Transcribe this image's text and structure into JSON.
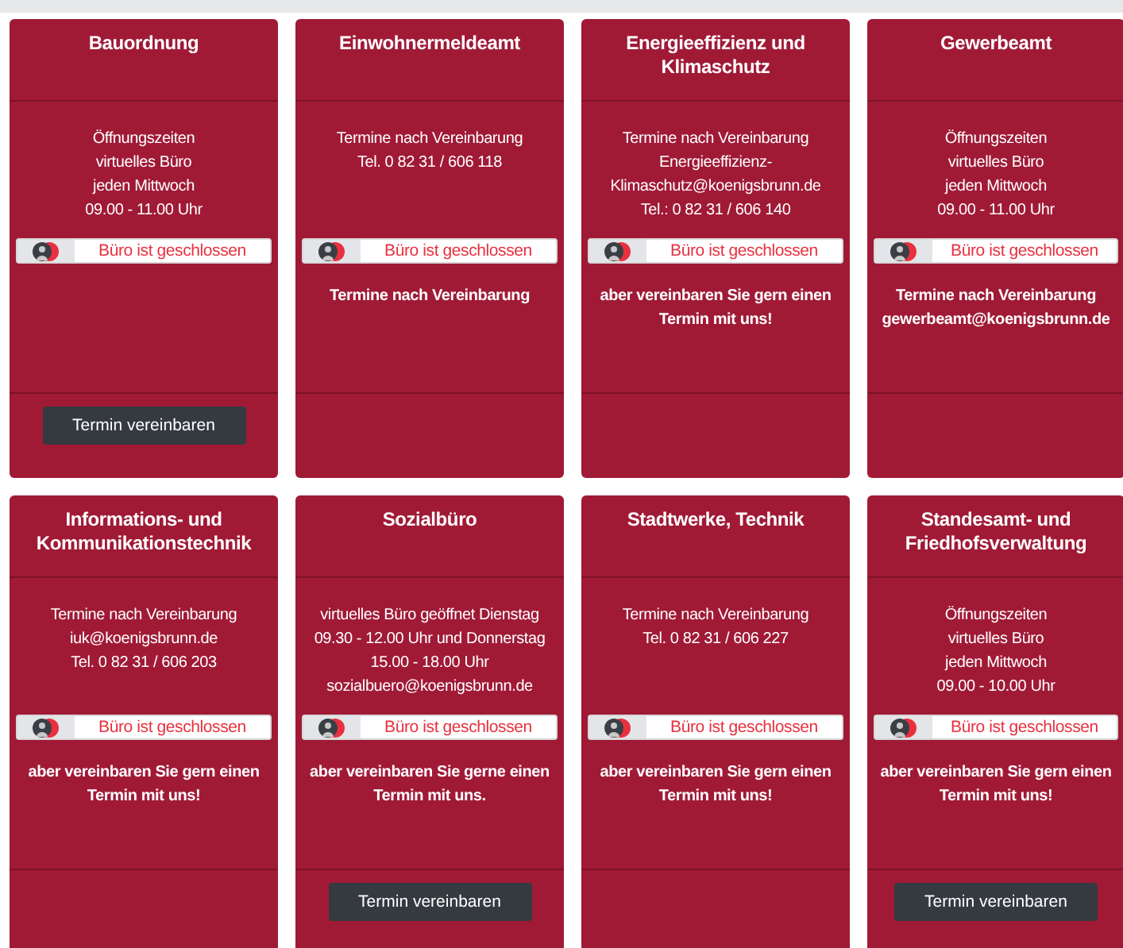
{
  "cards": [
    {
      "title": "Bauordnung",
      "info": [
        "Öffnungszeiten",
        "virtuelles Büro",
        "jeden Mittwoch",
        "09.00 - 11.00 Uhr"
      ],
      "status": {
        "text": "Büro ist geschlossen",
        "open": false
      },
      "button": "Termin vereinbaren"
    },
    {
      "title": "Einwohnermeldeamt",
      "info": [
        "Termine nach Vereinbarung",
        "Tel. 0 82 31 / 606 118"
      ],
      "status": {
        "text": "Büro ist geschlossen",
        "open": false
      },
      "note": [
        "Termine nach Vereinbarung"
      ]
    },
    {
      "title": "Energieeffizienz und Klimaschutz",
      "info": [
        "Termine nach Vereinbarung",
        "Energieeffizienz-",
        "Klimaschutz@koenigsbrunn.de",
        "Tel.: 0 82 31 / 606 140"
      ],
      "status": {
        "text": "Büro ist geschlossen",
        "open": false
      },
      "note": [
        "aber vereinbaren Sie gern einen",
        "Termin mit uns!"
      ]
    },
    {
      "title": "Gewerbeamt",
      "info": [
        "Öffnungszeiten",
        "virtuelles Büro",
        "jeden Mittwoch",
        "09.00 - 11.00 Uhr"
      ],
      "status": {
        "text": "Büro ist geschlossen",
        "open": false
      },
      "note": [
        "Termine nach Vereinbarung",
        "gewerbeamt@koenigsbrunn.de"
      ]
    },
    {
      "title": "Informations- und Kommunikationstechnik",
      "info": [
        "Termine nach Vereinbarung",
        "iuk@koenigsbrunn.de",
        "Tel. 0 82 31 / 606 203"
      ],
      "status": {
        "text": "Büro ist geschlossen",
        "open": false
      },
      "note": [
        "aber vereinbaren Sie gern einen",
        "Termin mit uns!"
      ]
    },
    {
      "title": "Sozialbüro",
      "info": [
        "virtuelles Büro geöffnet Dienstag",
        "09.30 - 12.00 Uhr und Donnerstag",
        "15.00 - 18.00 Uhr",
        "sozialbuero@koenigsbrunn.de"
      ],
      "status": {
        "text": "Büro ist geschlossen",
        "open": false
      },
      "note": [
        "aber vereinbaren Sie gerne einen",
        "Termin mit uns."
      ],
      "button": "Termin vereinbaren"
    },
    {
      "title": "Stadtwerke, Technik",
      "info": [
        "Termine nach Vereinbarung",
        "Tel. 0 82 31 / 606 227"
      ],
      "status": {
        "text": "Büro ist geschlossen",
        "open": false
      },
      "note": [
        "aber vereinbaren Sie gern einen",
        "Termin mit uns!"
      ]
    },
    {
      "title": "Standesamt- und Friedhofsverwaltung",
      "info": [
        "Öffnungszeiten",
        "virtuelles Büro",
        "jeden Mittwoch",
        "09.00 - 10.00 Uhr"
      ],
      "status": {
        "text": "Büro ist geschlossen",
        "open": false
      },
      "note": [
        "aber vereinbaren Sie gern einen",
        "Termin mit uns!"
      ],
      "button": "Termin vereinbaren"
    }
  ]
}
